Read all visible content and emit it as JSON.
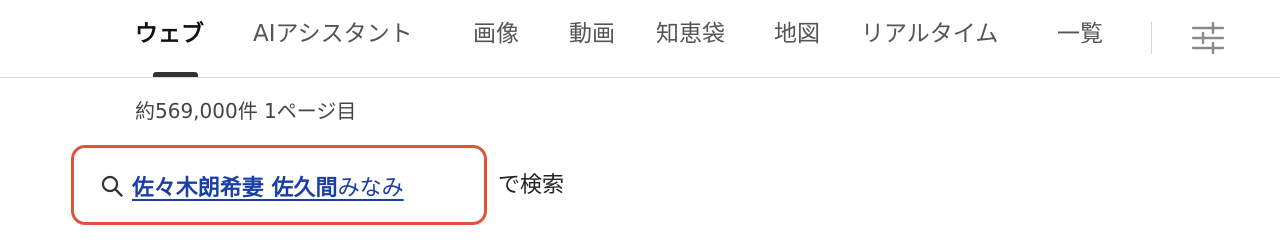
{
  "tabs": [
    {
      "label": "ウェブ",
      "active": true
    },
    {
      "label": "AIアシスタント",
      "active": false
    },
    {
      "label": "画像",
      "active": false
    },
    {
      "label": "動画",
      "active": false
    },
    {
      "label": "知恵袋",
      "active": false
    },
    {
      "label": "地図",
      "active": false
    },
    {
      "label": "リアルタイム",
      "active": false
    },
    {
      "label": "一覧",
      "active": false
    }
  ],
  "settings_icon": "sliders-icon",
  "result_count": "約569,000件  1ページ目",
  "suggestion": {
    "icon": "search-icon",
    "query_bold": "佐々木朗希妻 佐久間",
    "query_rest": "みなみ",
    "suffix": "で検索",
    "highlight_color": "#e0533b",
    "link_color": "#1a3ea8"
  }
}
